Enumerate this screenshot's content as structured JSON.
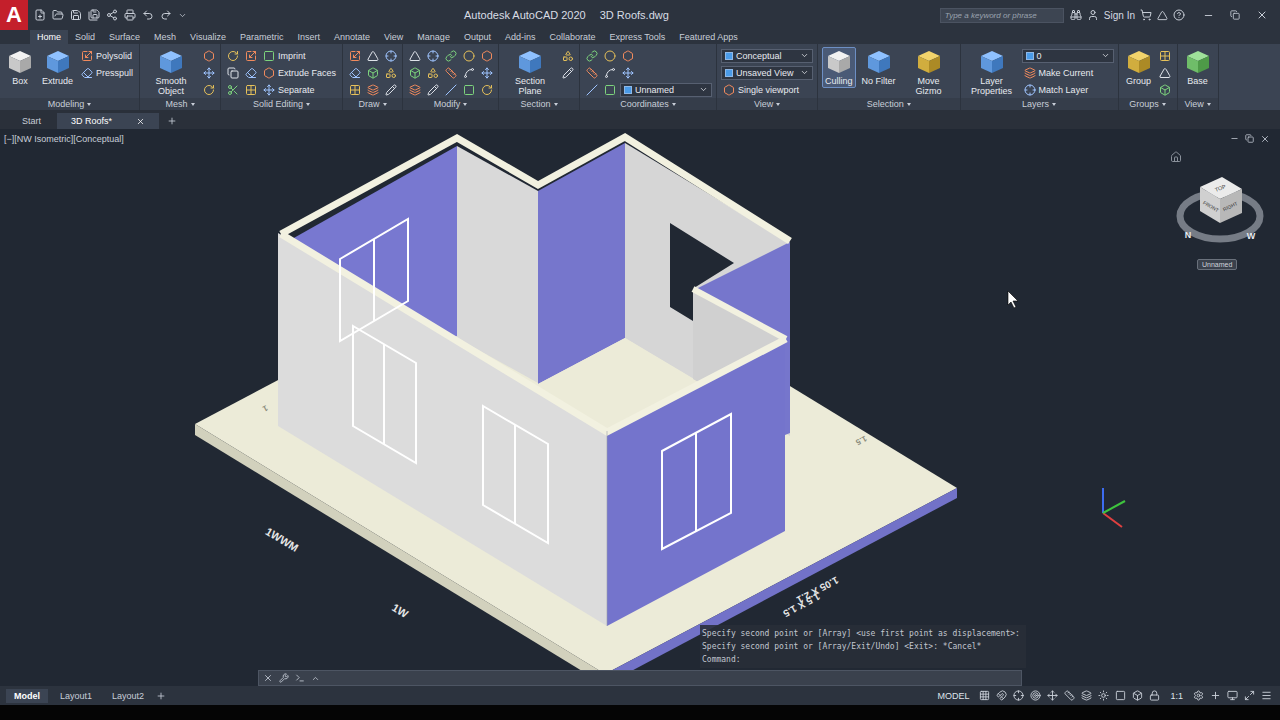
{
  "title_bar": {
    "logo": "A",
    "app": "Autodesk AutoCAD 2020",
    "file": "3D Roofs.dwg",
    "search_placeholder": "Type a keyword or phrase",
    "sign_in": "Sign In"
  },
  "ribbon_tabs": [
    {
      "label": "Home",
      "selected": true
    },
    {
      "label": "Solid",
      "selected": false
    },
    {
      "label": "Surface",
      "selected": false
    },
    {
      "label": "Mesh",
      "selected": false
    },
    {
      "label": "Visualize",
      "selected": false
    },
    {
      "label": "Parametric",
      "selected": false
    },
    {
      "label": "Insert",
      "selected": false
    },
    {
      "label": "Annotate",
      "selected": false
    },
    {
      "label": "View",
      "selected": false
    },
    {
      "label": "Manage",
      "selected": false
    },
    {
      "label": "Output",
      "selected": false
    },
    {
      "label": "Add-ins",
      "selected": false
    },
    {
      "label": "Collaborate",
      "selected": false
    },
    {
      "label": "Express Tools",
      "selected": false
    },
    {
      "label": "Featured Apps",
      "selected": false
    }
  ],
  "ribbon_panels": [
    {
      "title": "Modeling",
      "tools": [
        {
          "kind": "large",
          "label": "Box",
          "active": false
        },
        {
          "kind": "large",
          "label": "Extrude",
          "active": false
        },
        {
          "kind": "small",
          "label": "Polysolid",
          "active": false
        },
        {
          "kind": "small",
          "label": "Presspull",
          "active": false
        }
      ]
    },
    {
      "title": "Mesh",
      "tools": [
        {
          "kind": "large",
          "label": "Smooth Object",
          "active": false
        },
        {
          "kind": "icon",
          "active": false
        },
        {
          "kind": "icon",
          "active": false
        },
        {
          "kind": "icon",
          "active": false
        }
      ]
    },
    {
      "title": "Solid Editing",
      "tools": [
        {
          "kind": "icon",
          "active": false
        },
        {
          "kind": "icon",
          "active": false
        },
        {
          "kind": "icon",
          "active": false
        },
        {
          "kind": "icon",
          "active": false
        },
        {
          "kind": "icon",
          "active": false
        },
        {
          "kind": "icon",
          "active": false
        },
        {
          "kind": "small",
          "label": "Imprint",
          "active": false
        },
        {
          "kind": "small",
          "label": "Extrude Faces",
          "active": false
        },
        {
          "kind": "small",
          "label": "Separate",
          "active": false
        }
      ]
    },
    {
      "title": "Draw",
      "tools": [
        {
          "kind": "icon",
          "active": false
        },
        {
          "kind": "icon",
          "active": false
        },
        {
          "kind": "icon",
          "active": false
        },
        {
          "kind": "icon",
          "active": false
        },
        {
          "kind": "icon",
          "active": false
        },
        {
          "kind": "icon",
          "active": false
        },
        {
          "kind": "icon",
          "active": false
        },
        {
          "kind": "icon",
          "active": false
        },
        {
          "kind": "icon",
          "active": false
        }
      ]
    },
    {
      "title": "Modify",
      "tools": [
        {
          "kind": "icon",
          "active": false
        },
        {
          "kind": "icon",
          "active": false
        },
        {
          "kind": "icon",
          "active": false
        },
        {
          "kind": "icon",
          "active": false
        },
        {
          "kind": "icon",
          "active": false
        },
        {
          "kind": "icon",
          "active": false
        },
        {
          "kind": "icon",
          "active": false
        },
        {
          "kind": "icon",
          "active": false
        },
        {
          "kind": "icon",
          "active": false
        },
        {
          "kind": "icon",
          "active": false
        },
        {
          "kind": "icon",
          "active": false
        },
        {
          "kind": "icon",
          "active": false
        },
        {
          "kind": "icon",
          "active": false
        },
        {
          "kind": "icon",
          "active": false
        },
        {
          "kind": "icon",
          "active": false
        }
      ]
    },
    {
      "title": "Section",
      "tools": [
        {
          "kind": "large",
          "label": "Section Plane",
          "active": false
        },
        {
          "kind": "icon",
          "active": false
        },
        {
          "kind": "icon",
          "active": false
        }
      ]
    },
    {
      "title": "Coordinates",
      "tools": [
        {
          "kind": "icon",
          "active": false
        },
        {
          "kind": "icon",
          "active": false
        },
        {
          "kind": "icon",
          "active": false
        },
        {
          "kind": "icon",
          "active": false
        },
        {
          "kind": "icon",
          "active": false
        },
        {
          "kind": "icon",
          "active": false
        },
        {
          "kind": "icon",
          "active": false
        },
        {
          "kind": "icon",
          "active": false
        },
        {
          "kind": "dropdown",
          "label": "Unnamed",
          "active": false
        }
      ]
    },
    {
      "title": "View",
      "tools": [
        {
          "kind": "dropdown",
          "label": "Conceptual",
          "active": false
        },
        {
          "kind": "dropdown",
          "label": "Unsaved View",
          "active": false
        },
        {
          "kind": "small",
          "label": "Single viewport",
          "active": false
        }
      ]
    },
    {
      "title": "Selection",
      "tools": [
        {
          "kind": "large",
          "label": "Culling",
          "active": true
        },
        {
          "kind": "large",
          "label": "No Filter",
          "active": false
        },
        {
          "kind": "large",
          "label": "Move Gizmo",
          "active": false
        }
      ]
    },
    {
      "title": "Layers",
      "tools": [
        {
          "kind": "large",
          "label": "Layer Properties",
          "active": false
        },
        {
          "kind": "dropdown",
          "label": "0",
          "active": false
        },
        {
          "kind": "small",
          "label": "Make Current",
          "active": false
        },
        {
          "kind": "small",
          "label": "Match Layer",
          "active": false
        }
      ]
    },
    {
      "title": "Groups",
      "tools": [
        {
          "kind": "large",
          "label": "Group",
          "active": false
        },
        {
          "kind": "icon",
          "active": false
        },
        {
          "kind": "icon",
          "active": false
        },
        {
          "kind": "icon",
          "active": false
        }
      ]
    },
    {
      "title": "View",
      "tools": [
        {
          "kind": "large",
          "label": "Base",
          "active": false
        }
      ]
    }
  ],
  "file_tabs": [
    {
      "label": "Start",
      "selected": false
    },
    {
      "label": "3D Roofs*",
      "selected": true
    }
  ],
  "viewport": {
    "label": "[−][NW Isometric][Conceptual]",
    "view_cube": {
      "faces": [
        "TOP",
        "FRONT",
        "RIGHT"
      ],
      "compass": [
        "N",
        "W"
      ],
      "ucs_name": "Unnamed"
    },
    "drawing_labels": [
      {
        "text": "1WWM"
      },
      {
        "text": "1W"
      },
      {
        "text": "1.05 X 2.1"
      },
      {
        "text": "1.5 X 1.5"
      },
      {
        "text": "1.5"
      },
      {
        "text": "1"
      }
    ]
  },
  "command": {
    "history": [
      "Specify second point or [Array] <use first point as displacement>:",
      "Specify second point or [Array/Exit/Undo] <Exit>: *Cancel*",
      "Command:"
    ]
  },
  "status_bar": {
    "layout_tabs": [
      {
        "label": "Model",
        "selected": true
      },
      {
        "label": "Layout1",
        "selected": false
      },
      {
        "label": "Layout2",
        "selected": false
      }
    ],
    "space": "MODEL",
    "scale": "1:1"
  }
}
